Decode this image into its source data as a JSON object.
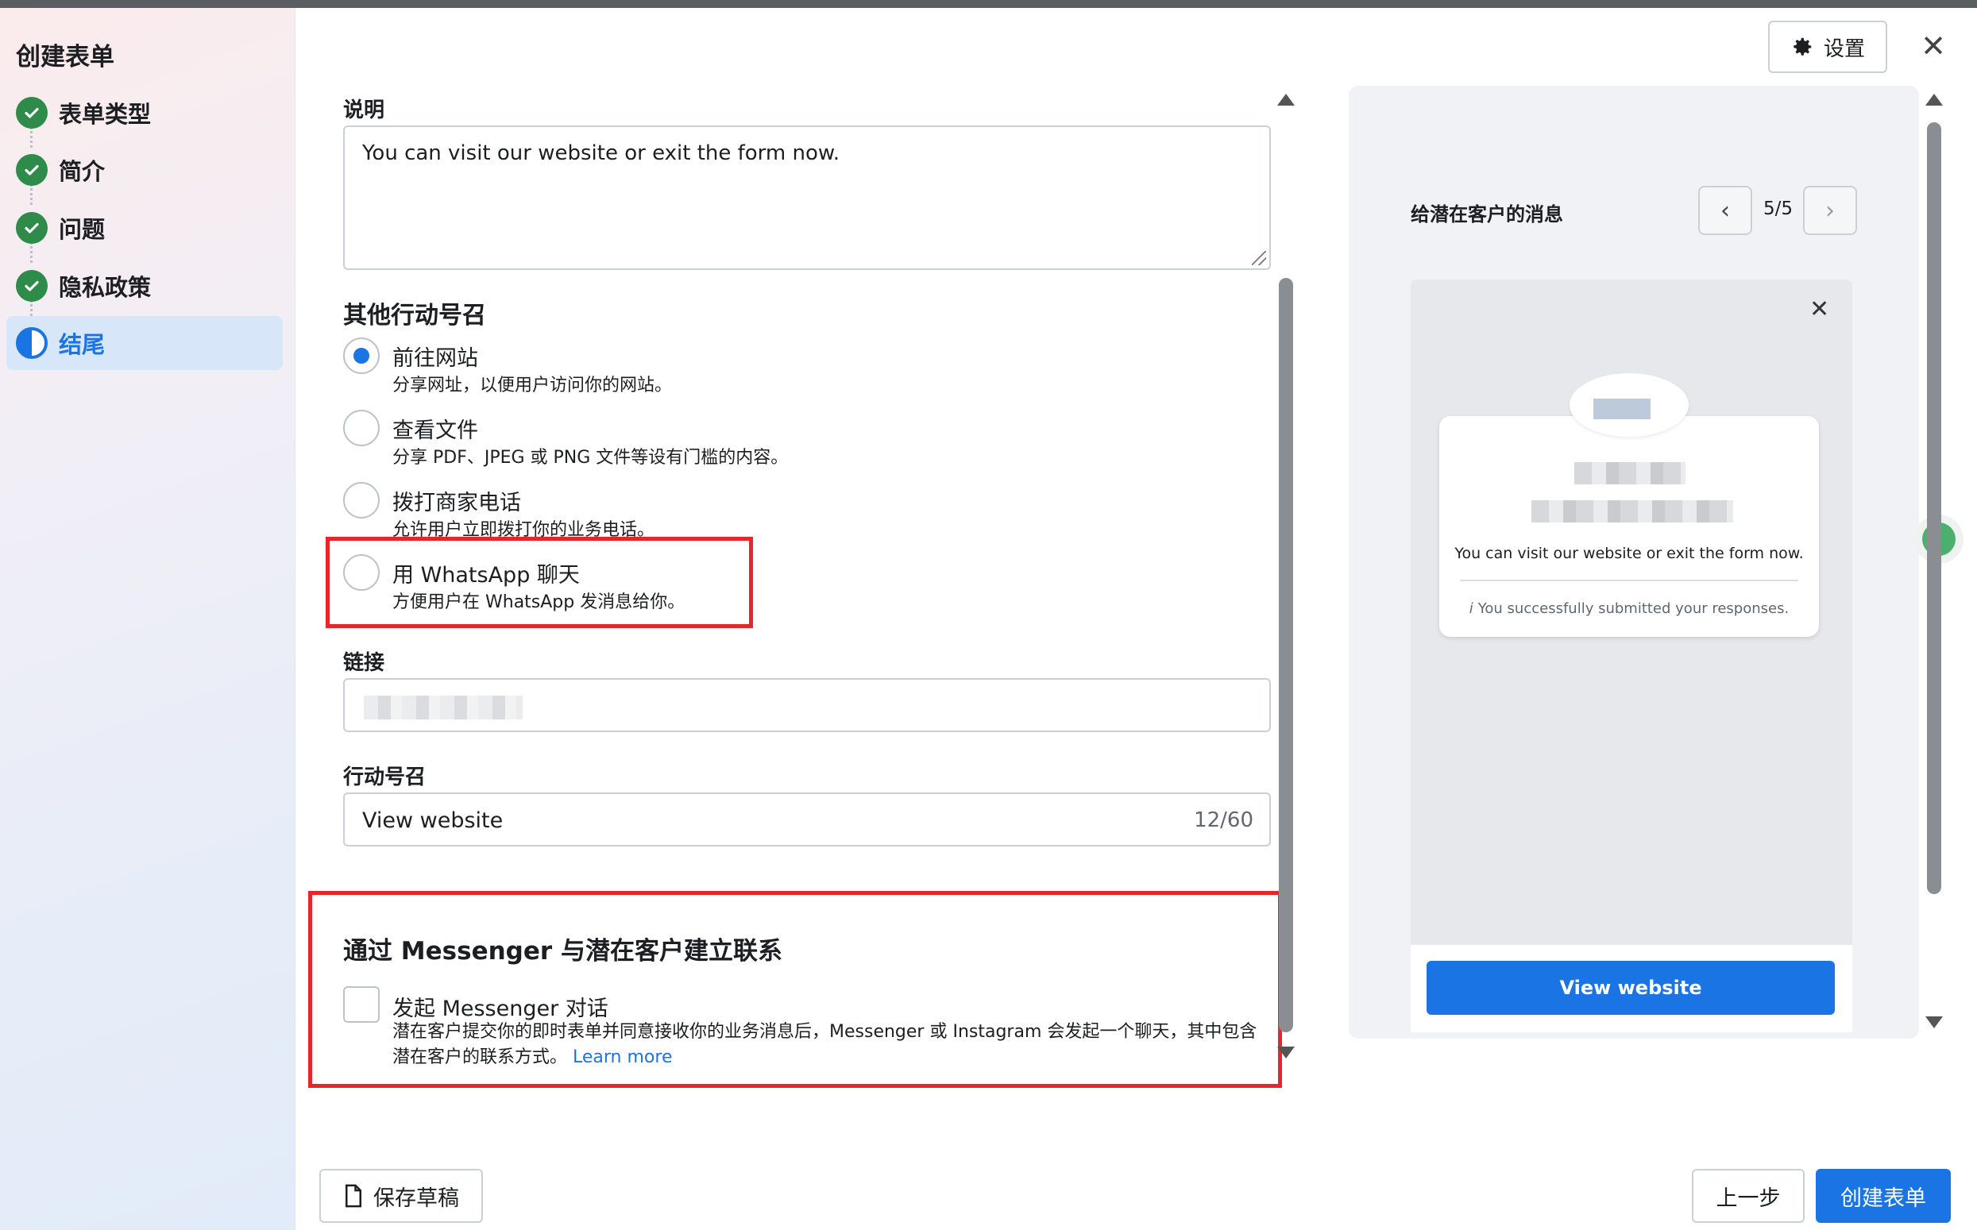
{
  "sidebar": {
    "title": "创建表单",
    "steps": [
      {
        "label": "表单类型",
        "status": "done"
      },
      {
        "label": "简介",
        "status": "done"
      },
      {
        "label": "问题",
        "status": "done"
      },
      {
        "label": "隐私政策",
        "status": "done"
      },
      {
        "label": "结尾",
        "status": "active"
      }
    ]
  },
  "header": {
    "settings_label": "设置",
    "close_icon": "close-icon"
  },
  "form": {
    "description_label": "说明",
    "description_value": "You can visit our website or exit the form now.",
    "cta_heading": "其他行动号召",
    "options": [
      {
        "title": "前往网站",
        "desc": "分享网址，以便用户访问你的网站。",
        "selected": true
      },
      {
        "title": "查看文件",
        "desc": "分享 PDF、JPEG 或 PNG 文件等设有门槛的内容。",
        "selected": false
      },
      {
        "title": "拨打商家电话",
        "desc": "允许用户立即拨打你的业务电话。",
        "selected": false
      },
      {
        "title": "用 WhatsApp 聊天",
        "desc": "方便用户在 WhatsApp 发消息给你。",
        "selected": false
      }
    ],
    "link_label": "链接",
    "cta_label": "行动号召",
    "cta_value": "View website",
    "cta_count": "12/60",
    "messenger_heading": "通过 Messenger 与潜在客户建立联系",
    "messenger_checkbox_title": "发起 Messenger 对话",
    "messenger_checkbox_desc": "潜在客户提交你的即时表单并同意接收你的业务消息后，Messenger 或 Instagram 会发起一个聊天，其中包含潜在客户的联系方式。",
    "learn_more": "Learn more"
  },
  "preview": {
    "title": "给潜在客户的消息",
    "pager": "5/5",
    "message": "You can visit our website or exit the form now.",
    "note_icon": "i",
    "note": "You successfully submitted your responses.",
    "cta_button": "View website"
  },
  "footer": {
    "save_draft": "保存草稿",
    "prev": "上一步",
    "create": "创建表单"
  },
  "colors": {
    "accent": "#1b74e4",
    "done_green": "#2e8b4a",
    "highlight_red": "#e8252a"
  }
}
